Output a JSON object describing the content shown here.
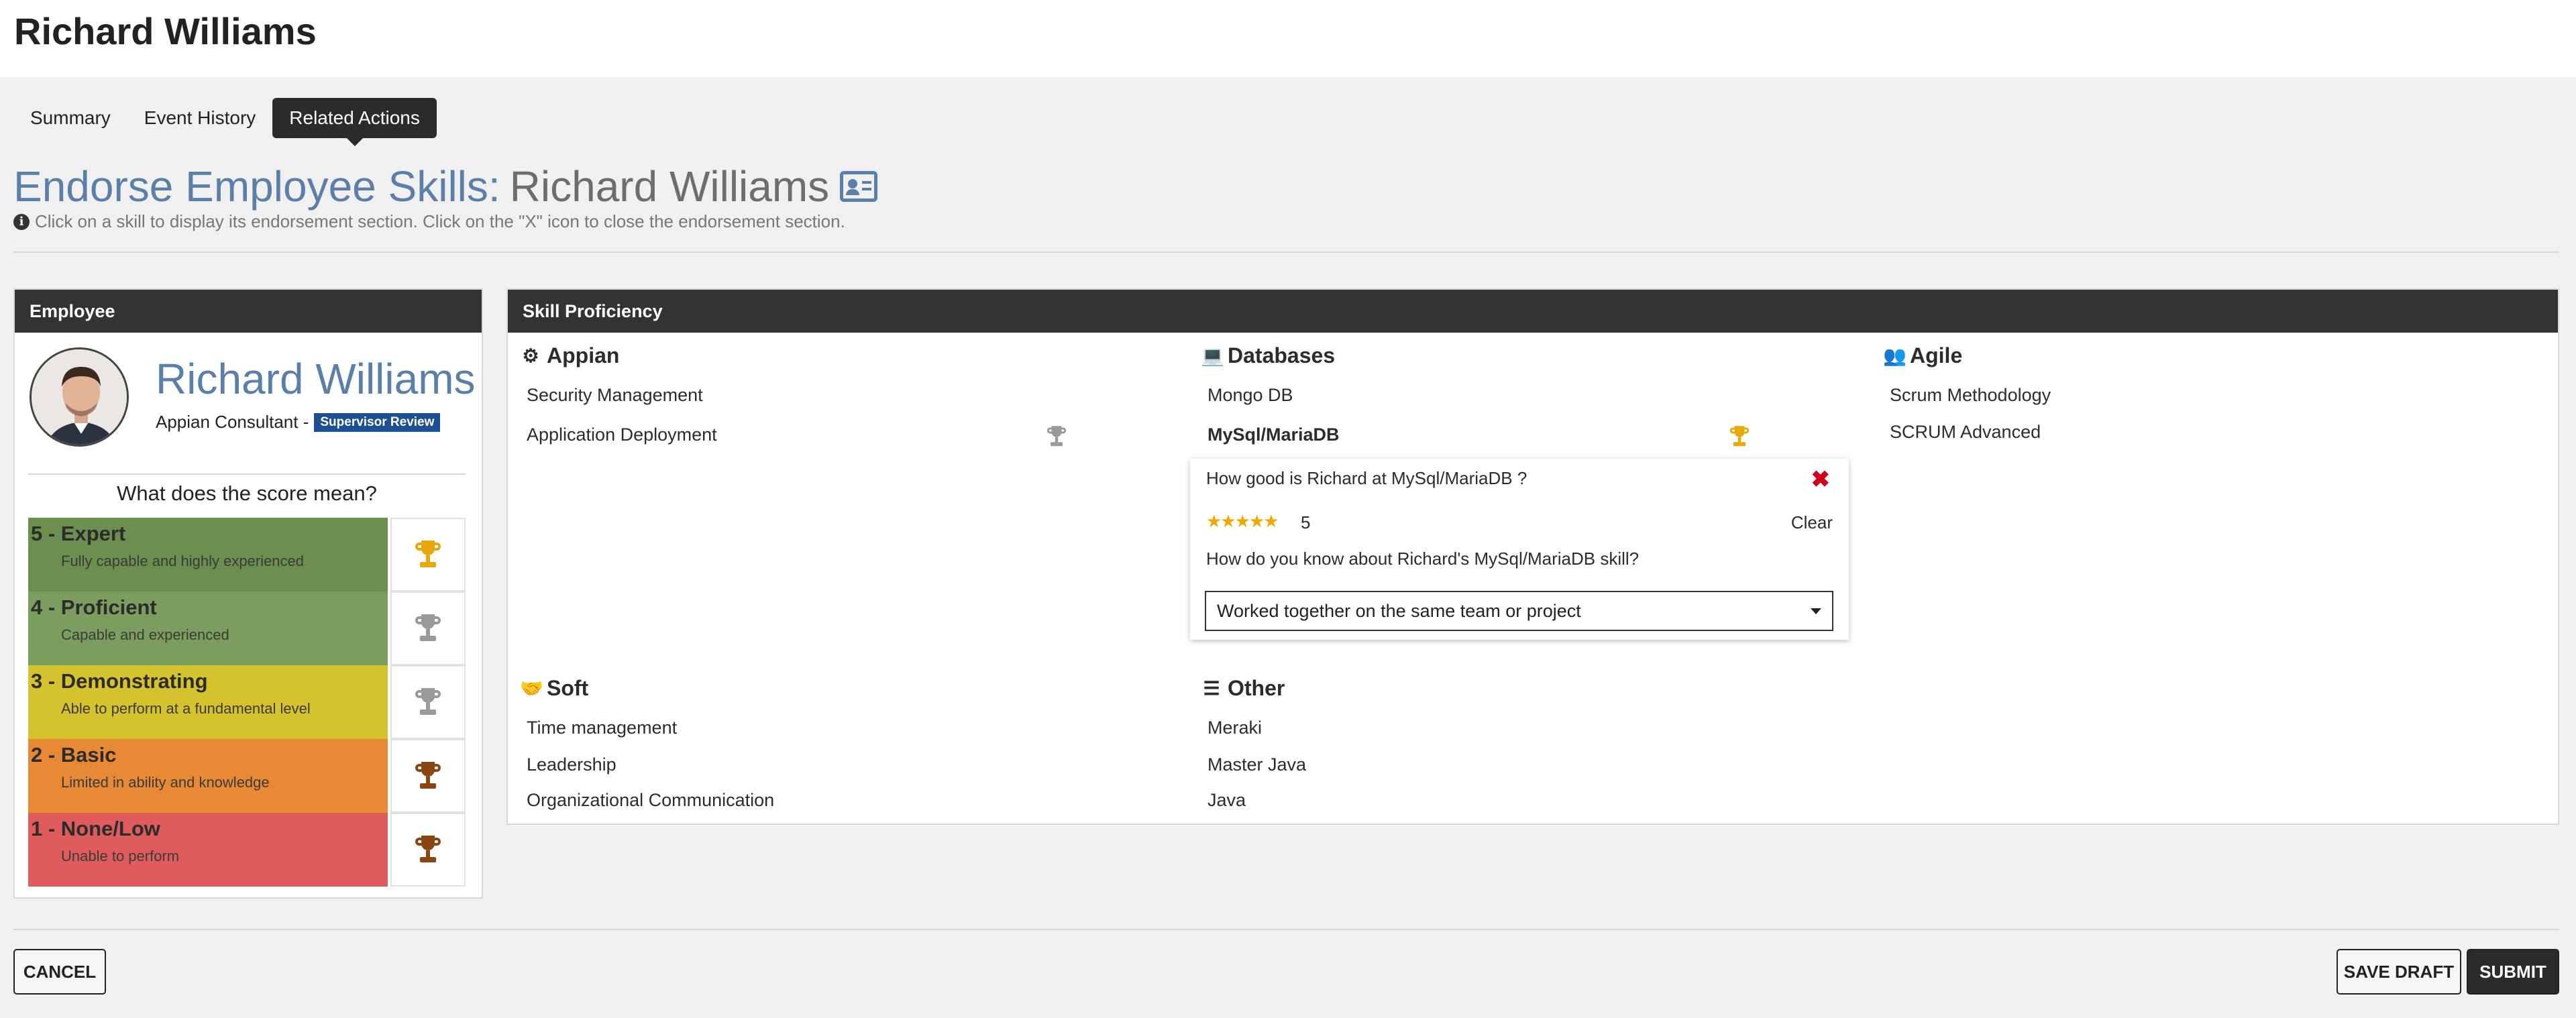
{
  "page": {
    "title": "Richard Williams"
  },
  "tabs": [
    {
      "label": "Summary"
    },
    {
      "label": "Event History"
    },
    {
      "label": "Related Actions"
    }
  ],
  "heading": {
    "accent": "Endorse Employee Skills:",
    "name": "Richard Williams",
    "info": "Click on a skill to display its endorsement section. Click on the \"X\" icon to close the endorsement section."
  },
  "employee": {
    "header": "Employee",
    "name": "Richard Williams",
    "role": "Appian Consultant -",
    "badge": "Supervisor Review",
    "score_title": "What does the score mean?",
    "levels": [
      {
        "title": "5 - Expert",
        "desc": "Fully capable and highly experienced",
        "color": "#6a8f4e",
        "trophy": "#e8a80c"
      },
      {
        "title": "4 - Proficient",
        "desc": "Capable and experienced",
        "color": "#7b9e5f",
        "trophy": "#9a9a9a"
      },
      {
        "title": "3 - Demonstrating",
        "desc": "Able to perform at a fundamental level",
        "color": "#d5c32e",
        "trophy": "#9a9a9a"
      },
      {
        "title": "2 - Basic",
        "desc": "Limited in ability and knowledge",
        "color": "#e88a35",
        "trophy": "#8b4513"
      },
      {
        "title": "1 - None/Low",
        "desc": "Unable to perform",
        "color": "#e05c5c",
        "trophy": "#8b4513"
      }
    ]
  },
  "skills": {
    "header": "Skill Proficiency",
    "appian": {
      "title": "Appian",
      "icon": "cogs-icon",
      "items": [
        "Security Management",
        "Application Deployment"
      ]
    },
    "databases": {
      "title": "Databases",
      "icon": "laptop-icon",
      "items": [
        "Mongo DB",
        "MySql/MariaDB"
      ]
    },
    "agile": {
      "title": "Agile",
      "icon": "users-icon",
      "items": [
        "Scrum Methodology",
        "SCRUM Advanced"
      ]
    },
    "soft": {
      "title": "Soft",
      "icon": "handshake-icon",
      "items": [
        "Time management",
        "Leadership",
        "Organizational Communication"
      ]
    },
    "other": {
      "title": "Other",
      "icon": "sliders-icon",
      "items": [
        "Meraki",
        "Master Java",
        "Java"
      ]
    }
  },
  "endorsement": {
    "question1": "How good is Richard at MySql/MariaDB ?",
    "stars": "★★★★★",
    "score": "5",
    "clear": "Clear",
    "question2": "How do you know about Richard's MySql/MariaDB skill?",
    "selected": "Worked together on the same team or project"
  },
  "buttons": {
    "cancel": "Cancel",
    "save_draft": "Save Draft",
    "submit": "Submit"
  }
}
